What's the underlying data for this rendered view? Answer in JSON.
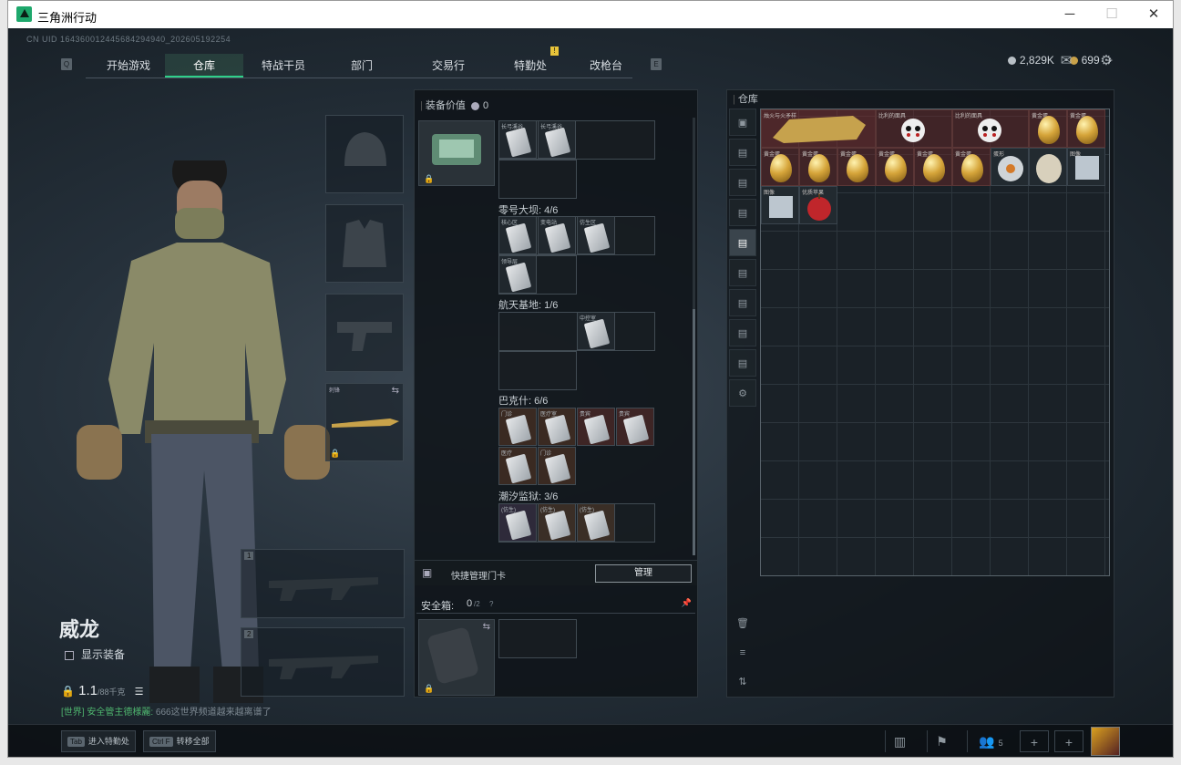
{
  "window": {
    "title": "三角洲行动",
    "min": "─",
    "max": "☐",
    "close": "✕"
  },
  "uid": "CN UID 164360012445684294940_202605192254",
  "nav": {
    "q": "Q",
    "e": "E",
    "tabs": [
      "开始游戏",
      "仓库",
      "特战干员",
      "部门",
      "交易行",
      "特勤处",
      "改枪台"
    ],
    "badge": "!"
  },
  "currency": {
    "silver": "2,829K",
    "gold": "699",
    "plus": "+"
  },
  "character": {
    "name": "威龙",
    "show_equipment": "显示装备",
    "weight": "1.1",
    "weight_max": "/88千克",
    "weapon_label": "刺锋"
  },
  "chat": {
    "channel": "[世界]",
    "user": "安全管主德様麗:",
    "message": "666这世界频道越来越离谱了"
  },
  "weapon_slots": [
    "1",
    "2"
  ],
  "middle": {
    "value_label": "装备价值",
    "value": "0",
    "groups": [
      {
        "name": "",
        "count": "",
        "cards": [
          "长弓溪谷",
          "长弓溪谷"
        ]
      },
      {
        "name": "零号大坝",
        "count": "4/6",
        "cards": [
          "核心区",
          "变电站",
          "仿生区",
          "领导层"
        ]
      },
      {
        "name": "航天基地",
        "count": "1/6",
        "cards": [
          "中控室"
        ]
      },
      {
        "name": "巴克什",
        "count": "6/6",
        "cards": [
          "门诊",
          "医疗室",
          "贵宾",
          "贵宾",
          "医疗",
          "门诊"
        ]
      },
      {
        "name": "潮汐监狱",
        "count": "3/6",
        "cards": [
          "(仿生)",
          "(仿生)",
          "(仿生)"
        ]
      }
    ],
    "manage_label": "快捷管理门卡",
    "manage_btn": "管理",
    "safebox_label": "安全箱:",
    "safebox_value": "0",
    "safebox_max": "/2",
    "help": "?"
  },
  "stash": {
    "title": "仓库",
    "items": [
      "烛火与火矛样",
      "比利的面具",
      "比利的面具",
      "黄金蛋",
      "黄金蛋",
      "黄金蛋",
      "黄金蛋",
      "黄金蛋",
      "黄金蛋",
      "黄金蛋",
      "黄金蛋",
      "黄金蛋",
      "黄金蛋",
      "黄金蛋",
      "图像",
      "图像",
      "蛋形",
      "高级",
      "优质苹果"
    ]
  },
  "bottom": {
    "tab_key": "Tab",
    "tab_label": "进入特勤处",
    "ctrl_key": "Ctrl F",
    "ctrl_label": "转移全部",
    "friends": "5"
  }
}
